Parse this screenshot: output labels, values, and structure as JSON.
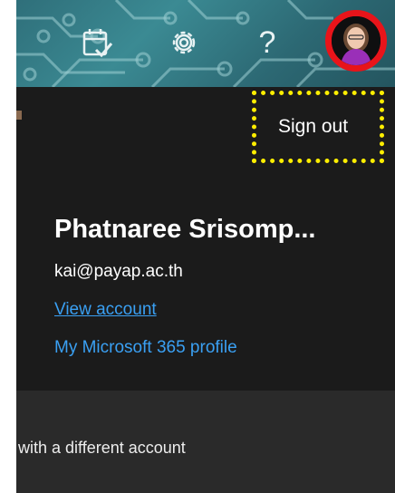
{
  "header": {
    "icons": [
      "calendar-check-icon",
      "gear-icon",
      "help-icon"
    ],
    "help_glyph": "?",
    "avatar_icon": "avatar-icon"
  },
  "account": {
    "sign_out_label": "Sign out",
    "display_name": "Phatnaree Srisomp...",
    "email": "kai@payap.ac.th",
    "view_account_label": "View account",
    "profile_label": "My Microsoft 365 profile"
  },
  "footer": {
    "different_account_label": "with a different account"
  },
  "colors": {
    "header_teal": "#3b8a93",
    "panel_bg": "#1b1b1b",
    "link_blue": "#3aa0f3",
    "highlight_red": "#e8141a",
    "highlight_yellow": "#ffee00"
  }
}
